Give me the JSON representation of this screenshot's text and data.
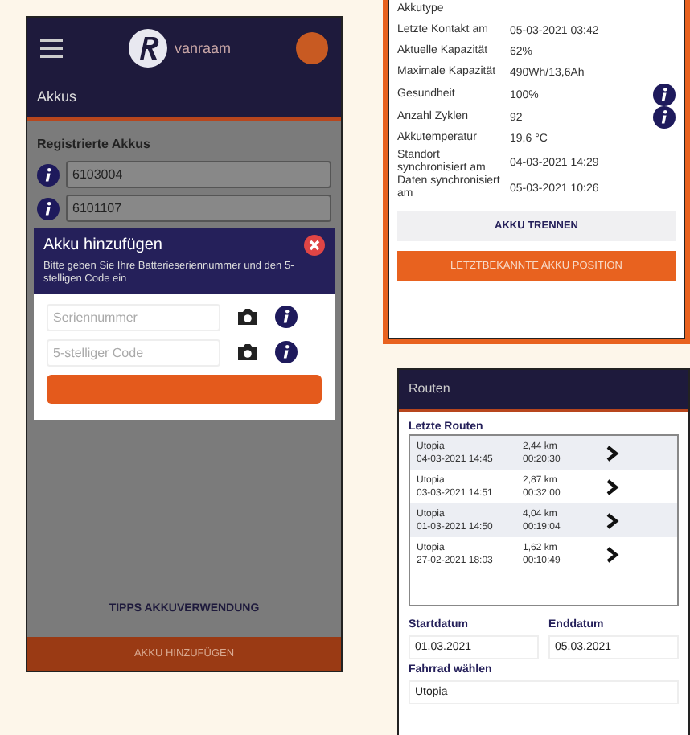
{
  "akkus_screen": {
    "header": {
      "logo_text": "vanraam"
    },
    "title": "Akkus",
    "section_title": "Registrierte Akkus",
    "batteries": [
      "6103004",
      "6101107"
    ],
    "dialog": {
      "title": "Akku hinzufügen",
      "description": "Bitte geben Sie Ihre Batterieseriennummer und den 5-stelligen Code ein",
      "fields": [
        {
          "placeholder": "Seriennummer"
        },
        {
          "placeholder": "5-stelliger Code"
        }
      ]
    },
    "tips_link": "TIPPS AKKUVERWENDUNG",
    "add_button": "AKKU HINZUFÜGEN"
  },
  "akku_details_screen": {
    "rows": [
      {
        "label": "Akkutype",
        "info": false
      },
      {
        "label": "Letzte Kontakt am",
        "value": "05-03-2021 03:42",
        "info": false
      },
      {
        "label": "Aktuelle Kapazität",
        "value": "62%",
        "info": false
      },
      {
        "label": "Maximale Kapazität",
        "value": "490Wh/13,6Ah",
        "info": false
      },
      {
        "label": "Gesundheit",
        "value": "100%",
        "info": true
      },
      {
        "label": "Anzahl Zyklen",
        "value": "92",
        "info": true
      },
      {
        "label": "Akkutemperatur",
        "value": "19,6 °C",
        "info": false
      },
      {
        "label": "Standort synchronisiert am",
        "value": "04-03-2021 14:29",
        "info": false
      },
      {
        "label": "Daten synchronisiert am",
        "value": "05-03-2021 10:26",
        "info": false
      }
    ],
    "disconnect_button": "AKKU TRENNEN",
    "position_button": "LETZTBEKANNTE AKKU POSITION"
  },
  "routen_screen": {
    "title": "Routen",
    "section_title": "Letzte Routen",
    "routes": [
      {
        "bike": "Utopia",
        "date": "04-03-2021 14:45",
        "distance": "2,44 km",
        "duration": "00:20:30"
      },
      {
        "bike": "Utopia",
        "date": "03-03-2021 14:51",
        "distance": "2,87 km",
        "duration": "00:32:00"
      },
      {
        "bike": "Utopia",
        "date": "01-03-2021 14:50",
        "distance": "4,04 km",
        "duration": "00:19:04"
      },
      {
        "bike": "Utopia",
        "date": "27-02-2021 18:03",
        "distance": "1,62 km",
        "duration": "00:10:49"
      }
    ],
    "start_label": "Startdatum",
    "end_label": "Enddatum",
    "start_date": "01.03.2021",
    "end_date": "05.03.2021",
    "bike_label": "Fahrrad wählen",
    "bike_value": "Utopia"
  }
}
